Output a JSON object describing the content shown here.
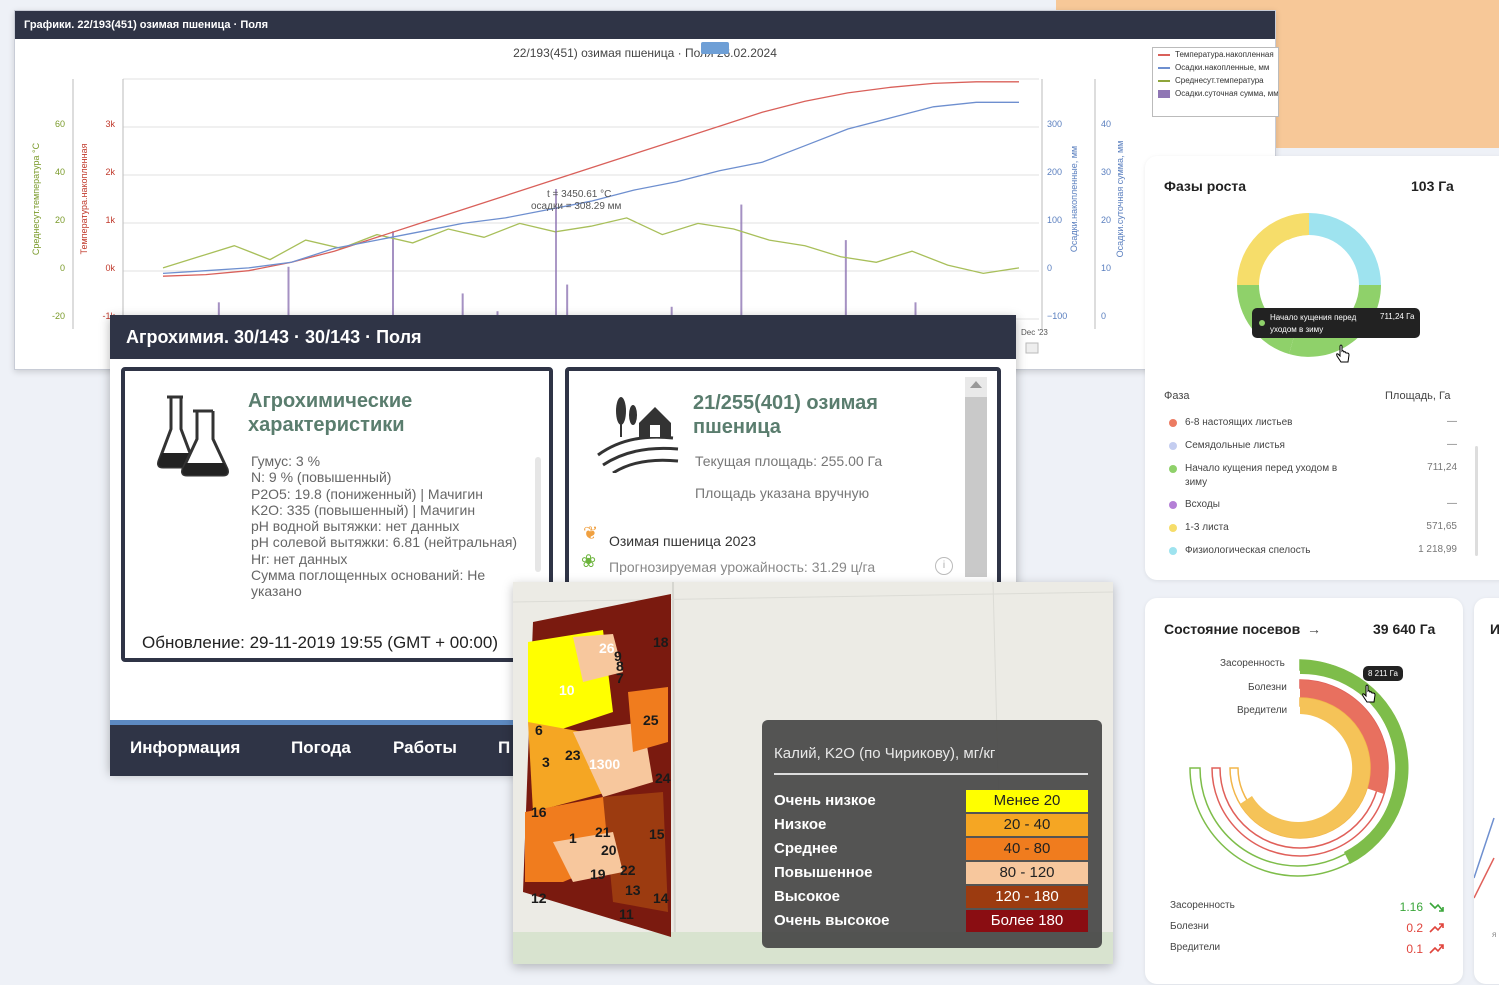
{
  "colors": {
    "dark": "#2f3446",
    "green": "#7ebd4a",
    "red": "#d9605a",
    "blue": "#6e8fcf",
    "olive": "#8ea53a",
    "purple": "#8f76b4",
    "peach": "#f7c898"
  },
  "chart_window": {
    "title": "Графики. 22/193(451) озимая пшеница · Поля",
    "chart_title": "22/193(451) озимая пшеница · Поля 26.02.2024",
    "left_axis1_label": "Среднесут.температура °С",
    "left_axis2_label": "Температура.накопленная",
    "right_axis1_label": "Осадки.накопленные, мм",
    "right_axis2_label": "Осадки.суточная сумма, мм",
    "axis1_ticks": [
      "60",
      "40",
      "20",
      "0",
      "-20"
    ],
    "axis2_ticks": [
      "3k",
      "2k",
      "1k",
      "0k",
      "-1k"
    ],
    "axis3_ticks": [
      "300",
      "200",
      "100",
      "0",
      "−100"
    ],
    "axis4_ticks": [
      "40",
      "30",
      "20",
      "10",
      "0"
    ],
    "x_tick": "Dec '23",
    "tooltip_line1": "t = 3450.61 °C",
    "tooltip_line2": "осадки = 308.29 мм",
    "legend": [
      {
        "label": "Температура.накопленная",
        "color": "#d9605a",
        "icon": "line"
      },
      {
        "label": "Осадки.накопленные, мм",
        "color": "#6e8fcf",
        "icon": "line"
      },
      {
        "label": "Среднесут.температура",
        "color": "#8ea53a",
        "icon": "line"
      },
      {
        "label": "Осадки.суточная сумма, мм",
        "color": "#8f76b4",
        "icon": "box"
      }
    ]
  },
  "chart_data": {
    "type": "line",
    "title": "22/193(451) озимая пшеница · Поля 26.02.2024",
    "x": "days (Sep 2023 – Feb 2024)",
    "series": [
      {
        "name": "Температура.накопленная",
        "axis": "Температура.накопленная",
        "end_value": 3450.61
      },
      {
        "name": "Осадки.накопленные, мм",
        "axis": "Осадки.накопленные, мм",
        "end_value": 308.29
      },
      {
        "name": "Среднесут.температура",
        "axis": "Среднесут.температура °С"
      },
      {
        "name": "Осадки.суточная сумма, мм",
        "axis": "Осадки.суточная сумма, мм"
      }
    ],
    "accumulated_temperature": [
      -50,
      -20,
      50,
      200,
      400,
      650,
      900,
      1150,
      1400,
      1650,
      1900,
      2150,
      2400,
      2650,
      2900,
      3100,
      3250,
      3350,
      3420,
      3450,
      3450
    ],
    "accumulated_precip": [
      0,
      5,
      10,
      20,
      45,
      60,
      75,
      90,
      100,
      115,
      130,
      150,
      165,
      185,
      200,
      230,
      260,
      280,
      300,
      308,
      308
    ],
    "daily_temp": [
      2,
      6,
      10,
      5,
      12,
      9,
      14,
      11,
      16,
      13,
      18,
      15,
      17,
      20,
      14,
      18,
      16,
      12,
      10,
      6,
      4,
      8,
      3,
      0,
      2
    ],
    "daily_precip": [
      0,
      6,
      0,
      14,
      0,
      3,
      22,
      0,
      8,
      4,
      0,
      10,
      2,
      0,
      5,
      0,
      28,
      3,
      0,
      20,
      0,
      6,
      2,
      0
    ],
    "ylim_temp": [
      -20,
      70
    ],
    "ylim_acc": [
      -1000,
      3500
    ],
    "ylim_acc_precip": [
      -100,
      350
    ],
    "ylim_daily_precip": [
      0,
      45
    ],
    "legend": "top-right"
  },
  "agro": {
    "title": "Агрохимия. 30/143 · 30/143 · Поля",
    "card1_title": "Агрохимические характеристики",
    "properties": [
      "Гумус: 3 %",
      "N: 9 % (повышенный)",
      "P2O5: 19.8 (пониженный) | Мачигин",
      "K2O: 335 (повышенный) | Мачигин",
      "pH водной вытяжки: нет данных",
      "pH солевой вытяжки: 6.81 (нейтральная)",
      "Hr: нет данных",
      "Сумма поглощенных оснований: Не указано"
    ],
    "updated": "Обновление: 29-11-2019 19:55 (GMT + 00:00)",
    "card2_title": "21/255(401) озимая пшеница",
    "area": "Текущая площадь: 255.00 Га",
    "area_note": "Площадь указана вручную",
    "crop": "Озимая пшеница 2023",
    "yield": "Прогнозируемая урожайность: 31.29 ц/га",
    "tabs": [
      "Информация",
      "Погода",
      "Работы",
      "П"
    ]
  },
  "map": {
    "legend_title": "Калий, K2O (по Чирикову), мг/кг",
    "rows": [
      {
        "label": "Очень низкое",
        "value": "Менее 20",
        "color": "#ffff00",
        "text": "#222"
      },
      {
        "label": "Низкое",
        "value": "20 - 40",
        "color": "#f5a623",
        "text": "#222"
      },
      {
        "label": "Среднее",
        "value": "40 - 80",
        "color": "#f07c1e",
        "text": "#222"
      },
      {
        "label": "Повышенное",
        "value": "80 - 120",
        "color": "#f7c79d",
        "text": "#222"
      },
      {
        "label": "Высокое",
        "value": "120 - 180",
        "color": "#9c3b10",
        "text": "#fff"
      },
      {
        "label": "Очень высокое",
        "value": "Более 180",
        "color": "#8a0d12",
        "text": "#fff"
      }
    ],
    "field_labels": [
      "26",
      "18",
      "9",
      "8",
      "7",
      "10",
      "25",
      "6",
      "23",
      "3",
      "1300",
      "24",
      "16",
      "1",
      "21",
      "20",
      "15",
      "19",
      "22",
      "13",
      "14",
      "12",
      "11"
    ]
  },
  "growth": {
    "title": "Фазы роста",
    "total": "103 Га",
    "tooltip_name": "Начало кущения перед уходом в зиму",
    "tooltip_value": "711,24 Га",
    "col_phase": "Фаза",
    "col_area": "Площадь, Га",
    "phases": [
      {
        "name": "6-8 настоящих листьев",
        "value": "—",
        "color": "#ec7b62"
      },
      {
        "name": "Семядольные листья",
        "value": "—",
        "color": "#c4cdf0"
      },
      {
        "name": "Начало кущения перед уходом в зиму",
        "value": "711,24",
        "color": "#8fd16a"
      },
      {
        "name": "Всходы",
        "value": "—",
        "color": "#b47fd6"
      },
      {
        "name": "1-3 листа",
        "value": "571,65",
        "color": "#f6dd6a"
      },
      {
        "name": "Физиологическая спелость",
        "value": "1 218,99",
        "color": "#9ee3ef"
      }
    ]
  },
  "crops": {
    "title": "Состояние посевов",
    "arrow": "→",
    "total": "39 640 Га",
    "tooltip": "8 211 Га",
    "ring_labels": [
      "Засоренность",
      "Болезни",
      "Вредители"
    ],
    "rows": [
      {
        "name": "Засоренность",
        "value": "1.16",
        "color": "#3aa63a",
        "trend": "down"
      },
      {
        "name": "Болезни",
        "value": "0.2",
        "color": "#e0443c",
        "trend": "up"
      },
      {
        "name": "Вредители",
        "value": "0.1",
        "color": "#e0443c",
        "trend": "up"
      }
    ]
  },
  "partial_panel": {
    "title": "И",
    "tick": "я"
  }
}
